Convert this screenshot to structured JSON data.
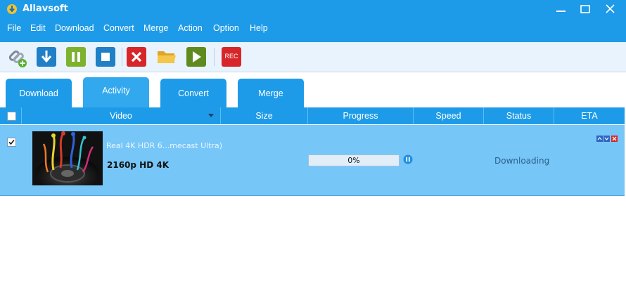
{
  "app": {
    "title": "Allavsoft"
  },
  "menu": [
    "File",
    "Edit",
    "Download",
    "Convert",
    "Merge",
    "Action",
    "Option",
    "Help"
  ],
  "toolbar": {
    "paste_icon": "link-add-icon",
    "download_icon": "download-arrow-icon",
    "pause_icon": "pause-icon",
    "stop_icon": "stop-icon",
    "delete_icon": "delete-x-icon",
    "folder_icon": "folder-icon",
    "play_icon": "play-icon",
    "rec_label": "REC"
  },
  "tabs": [
    "Download",
    "Activity",
    "Convert",
    "Merge"
  ],
  "table": {
    "columns": [
      "Video",
      "Size",
      "Progress",
      "Speed",
      "Status",
      "ETA"
    ],
    "rows": [
      {
        "checked": true,
        "title": "Real 4K HDR 6...mecast Ultra)",
        "quality": "2160p HD 4K",
        "progress": "0%",
        "progress_value": 0,
        "status": "Downloading"
      }
    ]
  },
  "colors": {
    "accent": "#1e9be8",
    "row_selected": "#77c6f8"
  }
}
